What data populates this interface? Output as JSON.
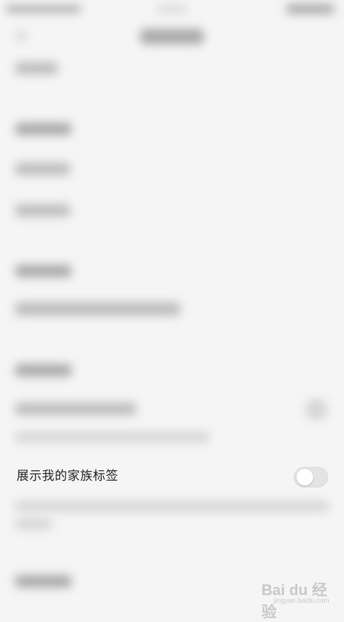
{
  "setting": {
    "label": "展示我的家族标签",
    "enabled": false
  },
  "watermark": {
    "brand": "Bai du 经验",
    "url": "jingyan.baidu.com"
  }
}
